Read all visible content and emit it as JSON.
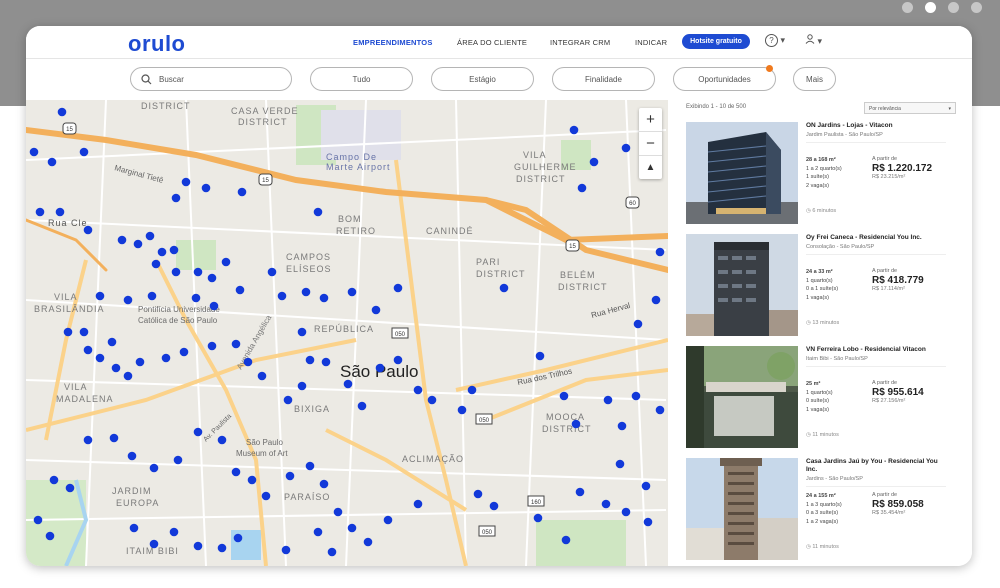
{
  "carousel": {
    "count": 4,
    "active": 1
  },
  "navbar": {
    "logo": "orulo",
    "items": [
      "EMPREENDIMENTOS",
      "ÁREA DO CLIENTE",
      "INTEGRAR CRM",
      "INDICAR"
    ],
    "hotsite_label": "Hotsite gratuito",
    "help_icon": "question-circle-icon",
    "user_icon": "user-icon"
  },
  "filters": {
    "search_placeholder": "Buscar",
    "pills": [
      "Tudo",
      "Estágio",
      "Finalidade",
      "Oportunidades",
      "Mais"
    ]
  },
  "map": {
    "city_label": "São Paulo",
    "labels": [
      "DISTRICT",
      "CASA VERDE",
      "DISTRICT",
      "Campo De",
      "Marte Airport",
      "VILA",
      "GUILHERME",
      "DISTRICT",
      "BOM",
      "RETIRO",
      "CANINDÉ",
      "PARI",
      "DISTRICT",
      "CAMPOS",
      "ELÍSEOS",
      "BELÉM",
      "DISTRICT",
      "Rua Cle",
      "VILA",
      "BRASILÂNDIA",
      "Pontifícia Universidade",
      "Católica de São Paulo",
      "REPÚBLICA",
      "Avenida Angélica",
      "Rua Herval",
      "Rua dos Trilhos",
      "VILA",
      "MADALENA",
      "BIXIGA",
      "MOOCA",
      "DISTRICT",
      "São Paulo",
      "Museum of Art",
      "ACLIMAÇÃO",
      "JARDIM",
      "EUROPA",
      "PARAÍSO",
      "ITAIM BIBI",
      "Marginal Tietê",
      "Av. Paulista",
      "15",
      "15",
      "15",
      "60",
      "050",
      "050",
      "050",
      "160"
    ],
    "zoom_in": "+",
    "zoom_out": "−",
    "compass": "▲"
  },
  "list": {
    "count_text": "Exibindo 1 - 10 de 500",
    "sort_label": "Por relevância",
    "cards": [
      {
        "title": "ON Jardins - Lojas - Vitacon",
        "location": "Jardim Paulista - São Paulo/SP",
        "specs": [
          "28 a 168 m²",
          "1 a 2 quarto(s)",
          "1 suíte(s)",
          "2 vaga(s)"
        ],
        "from": "A partir de",
        "price": "R$ 1.220.172",
        "per": "R$ 23.215/m²",
        "time": "6 minutos"
      },
      {
        "title": "Oy Frei Caneca - Residencial You Inc.",
        "location": "Consolação - São Paulo/SP",
        "specs": [
          "24 a 33 m²",
          "1 quarto(s)",
          "0 a 1 suíte(s)",
          "1 vaga(s)"
        ],
        "from": "A partir de",
        "price": "R$ 418.779",
        "per": "R$ 17.114/m²",
        "time": "13 minutos"
      },
      {
        "title": "VN Ferreira Lobo - Residencial Vitacon",
        "location": "Itaim Bibi - São Paulo/SP",
        "specs": [
          "25 m²",
          "1 quarto(s)",
          "0 suíte(s)",
          "1 vaga(s)"
        ],
        "from": "A partir de",
        "price": "R$ 955.614",
        "per": "R$ 27.156/m²",
        "time": "11 minutos"
      },
      {
        "title": "Casa Jardins Jaú by You - Residencial You Inc.",
        "location": "Jardins - São Paulo/SP",
        "specs": [
          "24 a 155 m²",
          "1 a 3 quarto(s)",
          "0 a 3 suíte(s)",
          "1 a 2 vaga(s)"
        ],
        "from": "A partir de",
        "price": "R$ 859.058",
        "per": "R$ 35.454/m²",
        "time": "11 minutos"
      }
    ]
  },
  "colors": {
    "brand": "#1e4bd2",
    "marker": "#1239d9",
    "highway": "#f3b05c",
    "road": "#fbd28a",
    "park": "#c7e6b7",
    "water": "#a8d4f0",
    "notification": "#f07a1e"
  }
}
